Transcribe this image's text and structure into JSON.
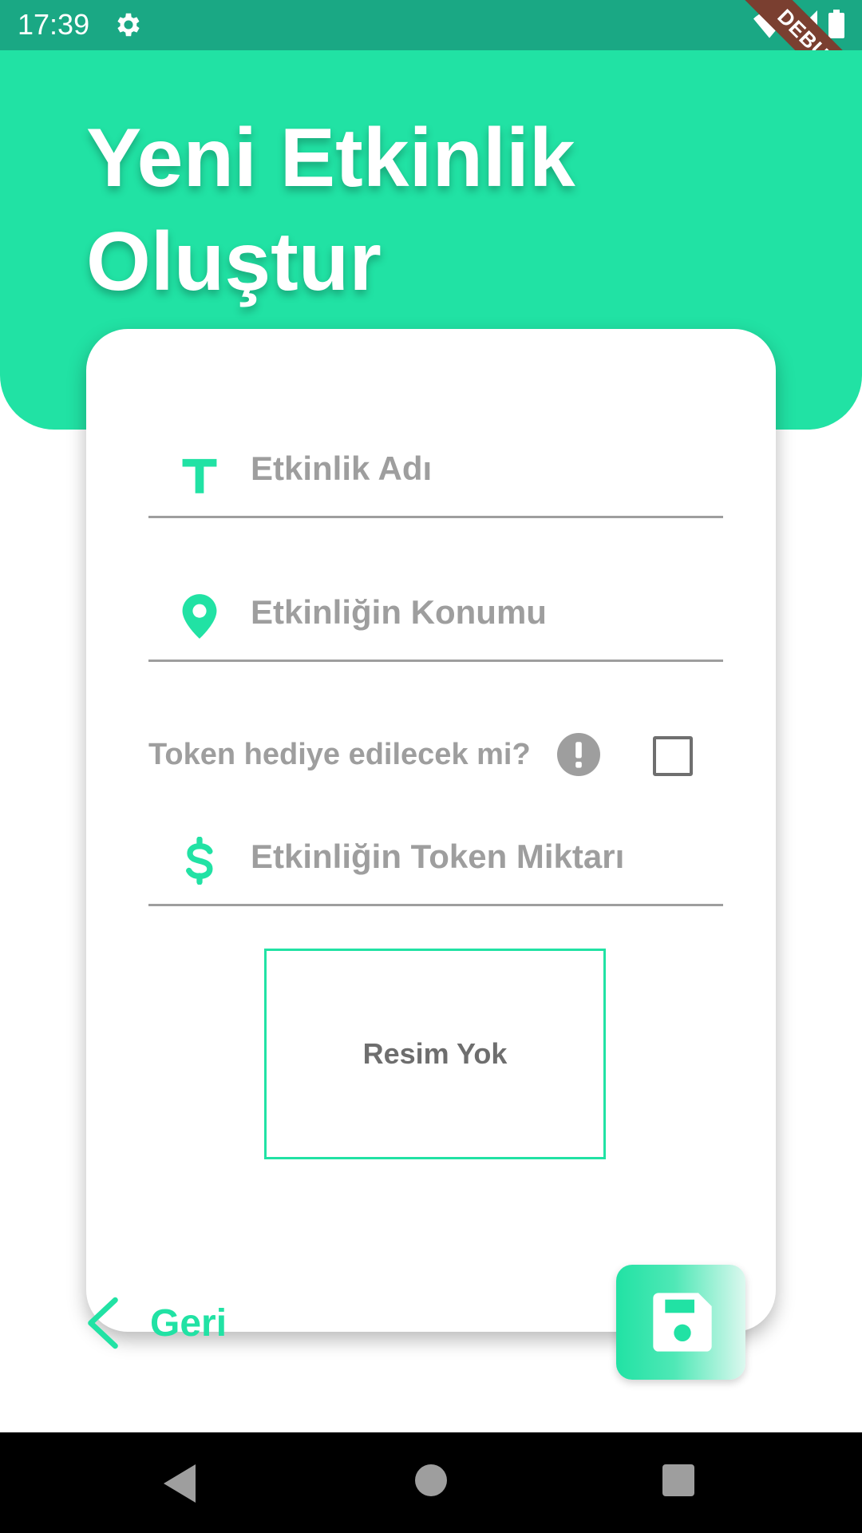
{
  "status_bar": {
    "time": "17:39",
    "debug_label": "DEBUG",
    "icons": [
      "gear-icon",
      "wifi-icon",
      "signal-icon",
      "battery-icon"
    ]
  },
  "header": {
    "title": "Yeni Etkinlik Oluştur"
  },
  "form": {
    "event_name": {
      "placeholder": "Etkinlik Adı",
      "value": "",
      "icon": "text-icon"
    },
    "event_location": {
      "placeholder": "Etkinliğin Konumu",
      "value": "",
      "icon": "location-pin-icon"
    },
    "token_gift": {
      "label": "Token hediye edilecek mi?",
      "checked": false,
      "info_icon": "info-icon"
    },
    "token_amount": {
      "placeholder": "Etkinliğin Token Miktarı",
      "value": "",
      "icon": "dollar-icon"
    },
    "image_placeholder": "Resim Yok"
  },
  "actions": {
    "back_label": "Geri",
    "save_icon": "save-icon"
  },
  "colors": {
    "accent": "#21e2a4",
    "status_bar": "#1aa884",
    "placeholder_text": "#9e9e9e",
    "debug_banner": "#7a3f30"
  },
  "nav_bar": {
    "icons": [
      "nav-back-icon",
      "nav-home-icon",
      "nav-recents-icon"
    ]
  }
}
